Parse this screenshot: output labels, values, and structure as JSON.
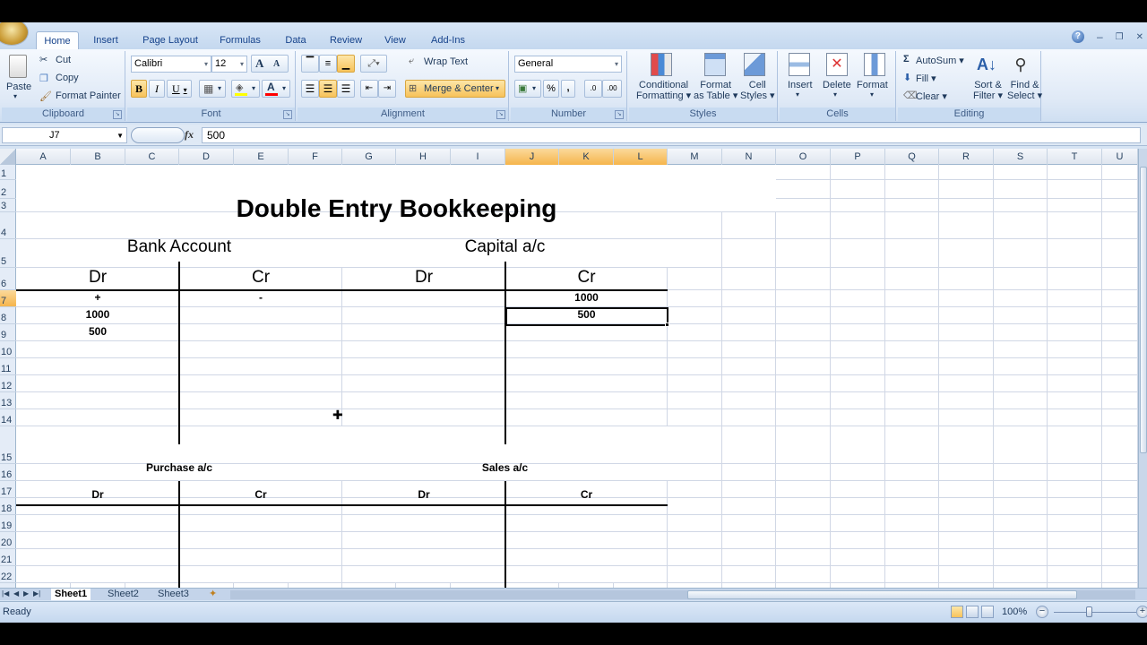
{
  "ribbon_tabs": [
    {
      "label": "Home",
      "active": true
    },
    {
      "label": "Insert",
      "active": false
    },
    {
      "label": "Page Layout",
      "active": false
    },
    {
      "label": "Formulas",
      "active": false
    },
    {
      "label": "Data",
      "active": false
    },
    {
      "label": "Review",
      "active": false
    },
    {
      "label": "View",
      "active": false
    },
    {
      "label": "Add-Ins",
      "active": false
    }
  ],
  "window_controls": {
    "help": "?",
    "minimize": "‒",
    "restore": "❐",
    "close": "✕"
  },
  "groups": {
    "clipboard": {
      "label": "Clipboard",
      "paste": "Paste",
      "cut": "Cut",
      "copy": "Copy",
      "format_painter": "Format Painter"
    },
    "font": {
      "label": "Font",
      "font_name": "Calibri",
      "font_size": "12",
      "bold": "B",
      "italic": "I",
      "underline": "U",
      "grow": "A",
      "shrink": "A",
      "font_color_glyph": "A",
      "fill_color": "#ffff00",
      "font_color": "#ff0000"
    },
    "alignment": {
      "label": "Alignment",
      "wrap_text": "Wrap Text",
      "merge_center": "Merge & Center"
    },
    "number": {
      "label": "Number",
      "format": "General",
      "percent": "%",
      "comma": ",",
      "inc_decimal": ".0",
      "dec_decimal": ".00"
    },
    "styles": {
      "label": "Styles",
      "conditional_formatting": [
        "Conditional",
        "Formatting ▾"
      ],
      "format_as_table": [
        "Format",
        "as Table ▾"
      ],
      "cell_styles": [
        "Cell",
        "Styles ▾"
      ]
    },
    "cells": {
      "label": "Cells",
      "insert": "Insert",
      "delete": "Delete",
      "format": "Format"
    },
    "editing": {
      "label": "Editing",
      "autosum": "AutoSum ▾",
      "fill": "Fill ▾",
      "clear": "Clear ▾",
      "sort_filter": [
        "Sort &",
        "Filter ▾"
      ],
      "find_select": [
        "Find &",
        "Select ▾"
      ]
    }
  },
  "formula_bar": {
    "name_box": "J7",
    "fx": "fx",
    "value": "500"
  },
  "columns": [
    "A",
    "B",
    "C",
    "D",
    "E",
    "F",
    "G",
    "H",
    "I",
    "J",
    "K",
    "L",
    "M",
    "N",
    "O",
    "P",
    "Q",
    "R",
    "S",
    "T",
    "U"
  ],
  "selected_columns": [
    "J",
    "K",
    "L"
  ],
  "rows": [
    "1",
    "2",
    "3",
    "4",
    "5",
    "6",
    "7",
    "8",
    "9",
    "10",
    "11",
    "12",
    "13",
    "14",
    "15",
    "16",
    "17",
    "18",
    "19",
    "20",
    "21",
    "22"
  ],
  "selected_row": "7",
  "sheet": {
    "title": "Double Entry Bookkeeping",
    "accounts": [
      {
        "name": "Bank Account",
        "dr": "Dr",
        "cr": "Cr",
        "dr_entries": [
          "+",
          "1000",
          "500"
        ],
        "cr_entries": [
          "-"
        ]
      },
      {
        "name": "Capital a/c",
        "dr": "Dr",
        "cr": "Cr",
        "dr_entries": [],
        "cr_entries": [
          "1000",
          "500"
        ]
      },
      {
        "name": "Purchase a/c",
        "dr": "Dr",
        "cr": "Cr",
        "dr_entries": [],
        "cr_entries": []
      },
      {
        "name": "Sales a/c",
        "dr": "Dr",
        "cr": "Cr",
        "dr_entries": [],
        "cr_entries": []
      }
    ],
    "selected_cell": "J7"
  },
  "sheet_tabs": [
    {
      "label": "Sheet1",
      "active": true
    },
    {
      "label": "Sheet2",
      "active": false
    },
    {
      "label": "Sheet3",
      "active": false
    }
  ],
  "status": {
    "text": "Ready",
    "zoom": "100%",
    "zoom_minus": "−",
    "zoom_plus": "+"
  }
}
